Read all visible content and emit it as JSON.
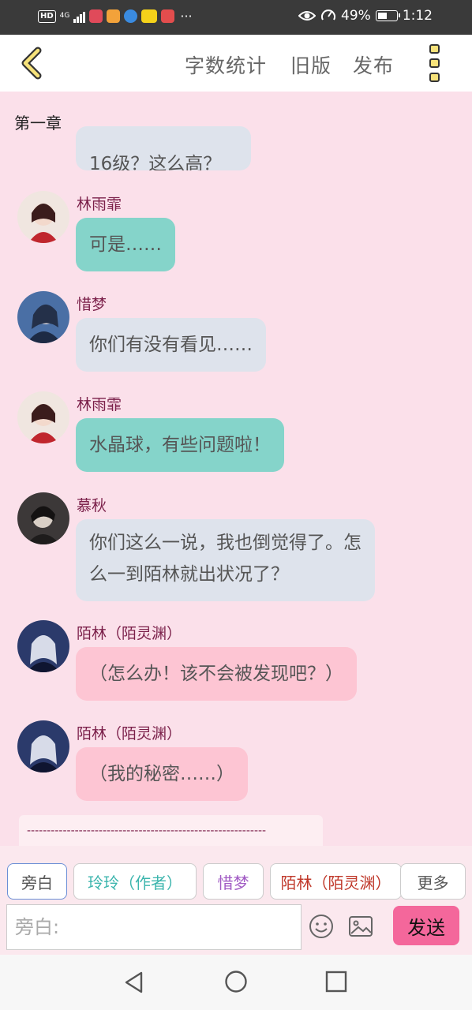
{
  "status_bar": {
    "hd": "HD",
    "network": "4G",
    "more": "···",
    "battery": "49%",
    "time": "1:12",
    "icons": [
      "eye-icon",
      "speed-icon",
      "battery-icon"
    ]
  },
  "toolbar": {
    "back_icon": "chevron-left-icon",
    "word_count": "字数统计",
    "old_version": "旧版",
    "publish": "发布",
    "menu_icon": "kebab-menu-icon"
  },
  "chapter_title": "第一章",
  "messages": [
    {
      "text": "16级？这么高？",
      "color": "grey"
    },
    {
      "sender": "林雨霏",
      "text": "可是……",
      "color": "teal"
    },
    {
      "sender": "惜梦",
      "text": "你们有没有看见……",
      "color": "grey"
    },
    {
      "sender": "林雨霏",
      "text": "水晶球，有些问题啦！",
      "color": "teal"
    },
    {
      "sender": "慕秋",
      "text_line1": "你们这么一说，我也倒觉得了。怎",
      "text_line2": "么一到陌林就出状况了？",
      "color": "grey"
    },
    {
      "sender": "陌林（陌灵渊）",
      "text": "（怎么办！该不会被发现吧？）",
      "color": "pink"
    },
    {
      "sender": "陌林（陌灵渊）",
      "text": "（我的秘密……）",
      "color": "pink"
    }
  ],
  "separator": "------------------------------------------------------------",
  "roles": [
    {
      "label": "旁白",
      "color": "#555555",
      "active": true
    },
    {
      "label": "玲玲（作者）",
      "color": "#3cb5ad"
    },
    {
      "label": "惜梦",
      "color": "#a15bc4"
    },
    {
      "label": "陌林（陌灵渊）",
      "color": "#c0392b"
    },
    {
      "label": "更多",
      "color": "#555555"
    }
  ],
  "composer": {
    "placeholder": "旁白:",
    "emoji_icon": "emoji-icon",
    "image_icon": "image-icon",
    "send": "发送"
  },
  "colors": {
    "chat_bg": "#fbe0ea",
    "sender_name": "#7a1f49",
    "bubble_grey": "#dee3ec",
    "bubble_teal": "#85d4ca",
    "bubble_pink": "#fdc5d3",
    "send_button": "#f4679b"
  }
}
